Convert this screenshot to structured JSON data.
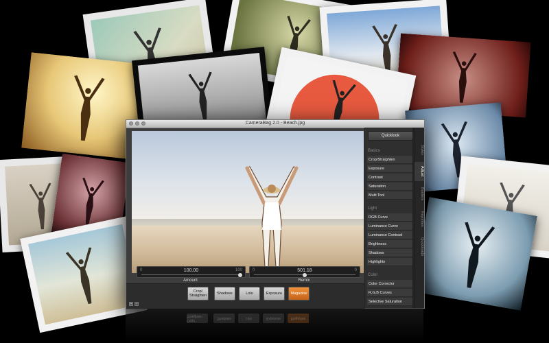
{
  "window": {
    "title": "CameraBag 2.0 - Beach.jpg"
  },
  "sliders": {
    "amount": {
      "value": "100.00",
      "min": "0",
      "max": "100",
      "label": "Amount"
    },
    "remix": {
      "value": "501.18",
      "min": "0",
      "max": "0",
      "label": "Remix"
    }
  },
  "filters": [
    {
      "label": "Crop/ Straighten",
      "active": false
    },
    {
      "label": "Shadows",
      "active": false
    },
    {
      "label": "Lolo",
      "active": false
    },
    {
      "label": "Exposure",
      "active": false
    },
    {
      "label": "Magazine",
      "active": true
    }
  ],
  "panel": {
    "quicklook": "Quicklook",
    "tabs": [
      "Styles",
      "Adjust",
      "Borders",
      "Favorites",
      "Quickloads"
    ],
    "active_tab": "Adjust",
    "sections": [
      {
        "title": "Basics",
        "items": [
          "Crop/Straighten",
          "Exposure",
          "Contrast",
          "Saturation",
          "Multi Tool"
        ]
      },
      {
        "title": "Light",
        "items": [
          "RGB Curve",
          "Luminance Curve",
          "Luminance Contrast",
          "Brightness",
          "Shadows",
          "Highlights"
        ]
      },
      {
        "title": "Color",
        "items": [
          "Color Corrector",
          "R,G,B Curves",
          "Selective Saturation"
        ]
      }
    ]
  },
  "colors": {
    "accent": "#e07a2a",
    "window_bg": "#3d3d3d",
    "panel_bg": "#2f2f2f"
  }
}
